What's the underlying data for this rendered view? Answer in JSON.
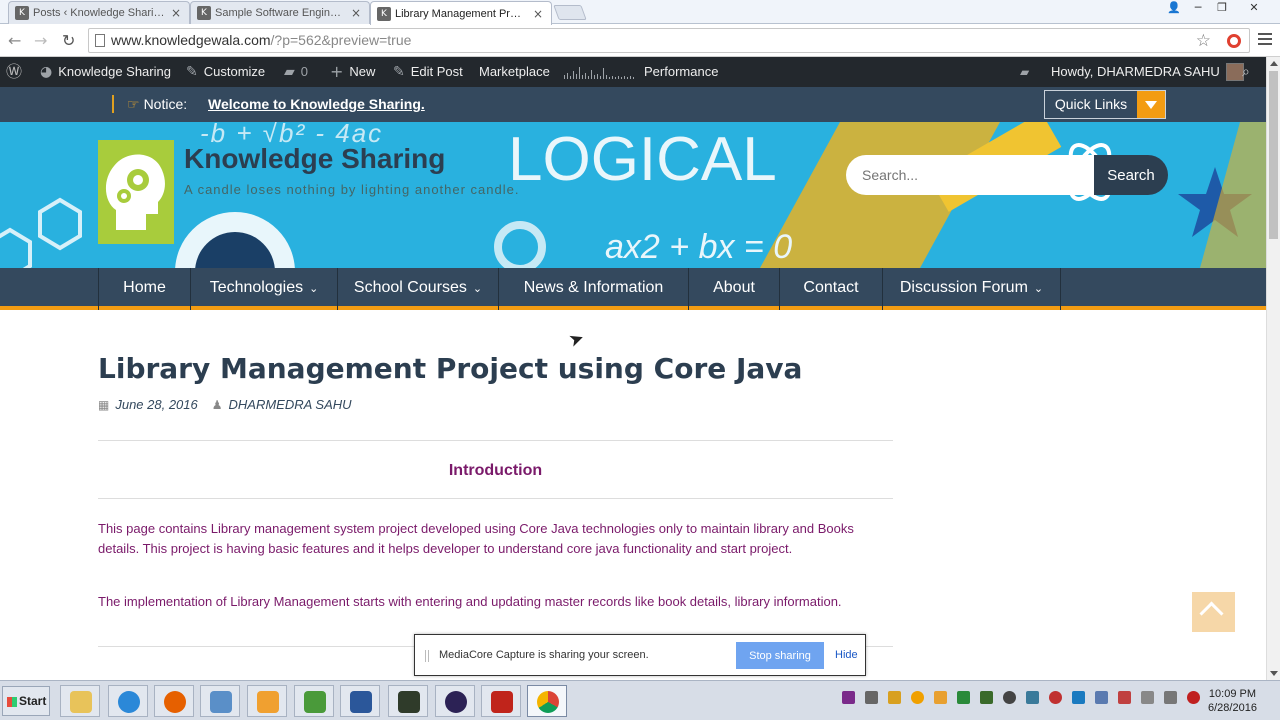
{
  "browser": {
    "tabs": [
      {
        "title": "Posts ‹ Knowledge Sharing —",
        "active": false
      },
      {
        "title": "Sample Software Engineering",
        "active": false
      },
      {
        "title": "Library Management Project",
        "active": true
      }
    ],
    "url_host": "www.knowledgewala.com",
    "url_rest": "/?p=562&preview=true",
    "window_controls": {
      "user": "👤",
      "minimize": "─",
      "restore": "❐",
      "close": "✕"
    }
  },
  "admin_bar": {
    "site": "Knowledge Sharing",
    "customize": "Customize",
    "comments_count": "0",
    "new": "New",
    "edit_post": "Edit Post",
    "marketplace": "Marketplace",
    "performance": "Performance",
    "greeting": "Howdy, DHARMEDRA SAHU"
  },
  "notice": {
    "label": "Notice:",
    "link": "Welcome to Knowledge Sharing.",
    "quick_links": "Quick Links"
  },
  "header": {
    "site_title": "Knowledge Sharing",
    "tagline": "A candle loses nothing by lighting another candle.",
    "search_placeholder": "Search...",
    "search_button": "Search",
    "banner_art": {
      "logical": "LOGICAL",
      "eq1": "-b + √b² - 4ac",
      "eq2": "ax2 + bx = 0"
    }
  },
  "nav": {
    "items": [
      {
        "label": "Home"
      },
      {
        "label": "Technologies",
        "caret": "⌄"
      },
      {
        "label": "School Courses",
        "caret": "⌄"
      },
      {
        "label": "News & Information"
      },
      {
        "label": "About"
      },
      {
        "label": "Contact"
      },
      {
        "label": "Discussion Forum",
        "caret": "⌄"
      }
    ]
  },
  "article": {
    "title": "Library Management Project using Core Java",
    "date": "June 28, 2016",
    "author": "DHARMEDRA SAHU",
    "section_heading": "Introduction",
    "paragraphs": [
      "This page contains Library management system project developed using Core Java technologies only to maintain library and Books details. This project is having basic features and it helps developer to understand core java functionality and start project.",
      "The implementation of Library Management starts with entering and updating master records like book details, library information."
    ]
  },
  "share_dialog": {
    "message": "MediaCore Capture is sharing your screen.",
    "stop": "Stop sharing",
    "hide": "Hide"
  },
  "taskbar": {
    "start": "Start",
    "time": "10:09 PM",
    "date": "6/28/2016"
  },
  "colors": {
    "accent": "#f39c12",
    "nav_bg": "#34495e",
    "banner_bg": "#29b1df",
    "article_text": "#7a1a6a"
  }
}
